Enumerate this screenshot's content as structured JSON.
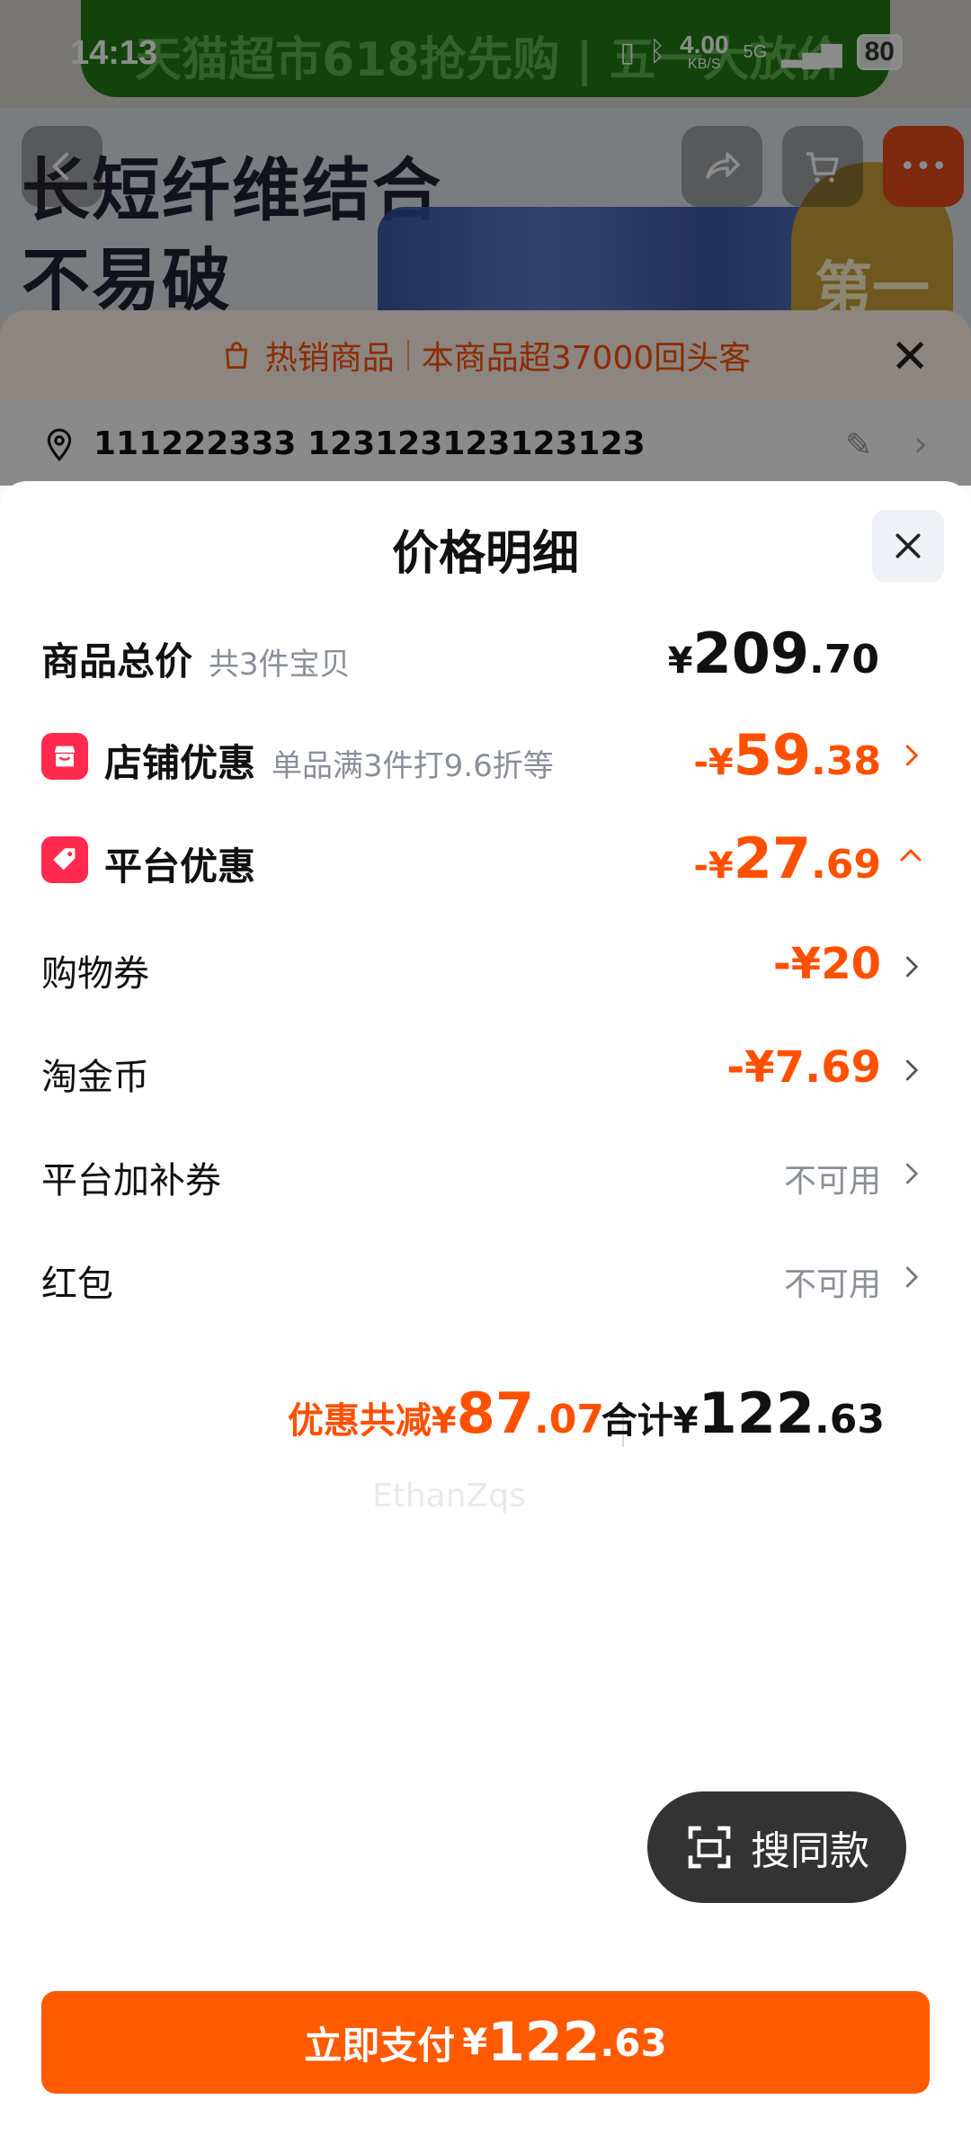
{
  "status_bar": {
    "time": "14:13",
    "network_speed": "4.00",
    "network_unit": "KB/S",
    "network_type": "5G",
    "battery": "80"
  },
  "background": {
    "ad_text": "天猫超市618抢先购 | 五一大放价",
    "hero_line1": "长短纤维结合",
    "hero_line2": "不易破",
    "medal_text": "第一",
    "hot_label": "热销商品",
    "hot_detail": "本商品超37000回头客",
    "address": "111222333 123123123123123"
  },
  "sheet": {
    "title": "价格明细",
    "total_price": {
      "label": "商品总价",
      "sub": "共3件宝贝",
      "currency": "¥",
      "int": "209",
      "dec": ".70"
    },
    "store_discount": {
      "label": "店铺优惠",
      "sub": "单品满3件打9.6折等",
      "prefix": "-¥",
      "int": "59",
      "dec": ".38"
    },
    "platform_discount": {
      "label": "平台优惠",
      "prefix": "-¥",
      "int": "27",
      "dec": ".69"
    },
    "coupon": {
      "label": "购物券",
      "amount": "-¥20"
    },
    "taojin": {
      "label": "淘金币",
      "amount": "-¥7.69"
    },
    "platform_subsidy": {
      "label": "平台加补券",
      "status": "不可用"
    },
    "red_packet": {
      "label": "红包",
      "status": "不可用"
    },
    "summary": {
      "save_label": "优惠共减",
      "save_currency": "¥",
      "save_int": "87",
      "save_dec": ".07",
      "total_label": "合计",
      "total_currency": "¥",
      "total_int": "122",
      "total_dec": ".63"
    }
  },
  "watermark": "EthanZqs",
  "search_same": {
    "label": "搜同款"
  },
  "pay_button": {
    "label": "立即支付",
    "currency": "¥",
    "int": "122",
    "dec": ".63"
  },
  "colors": {
    "accent": "#ff5000",
    "pay_button": "#ff5a00",
    "discount_icon": "#ff2a4d"
  }
}
